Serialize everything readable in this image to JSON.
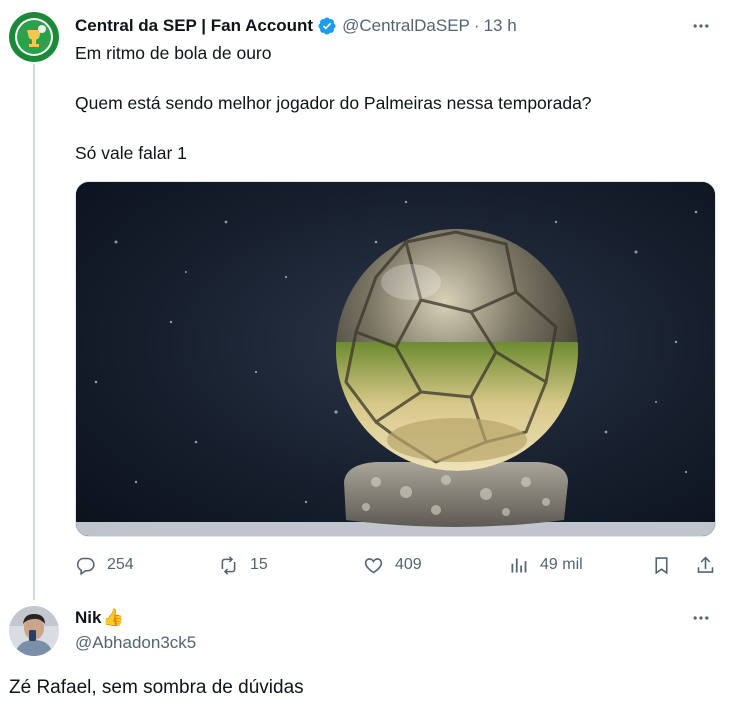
{
  "tweet": {
    "author_name": "Central da SEP | Fan Account",
    "author_handle": "@CentralDaSEP",
    "separator": "·",
    "time": "13 h",
    "lines": [
      "Em ritmo de bola de ouro",
      "Quem está sendo melhor jogador do Palmeiras nessa temporada?",
      "Só vale falar 1"
    ],
    "actions": {
      "replies": "254",
      "reposts": "15",
      "likes": "409",
      "views": "49 mil"
    }
  },
  "reply": {
    "author_name": "Nik",
    "author_emoji": "👍",
    "author_handle": "@Abhadon3ck5",
    "text": "Zé Rafael, sem sombra de dúvidas"
  },
  "icons": {
    "more": "more-horizontal-icon",
    "verified": "verified-badge-icon",
    "reply": "reply-icon",
    "repost": "repost-icon",
    "like": "heart-icon",
    "views": "analytics-icon",
    "bookmark": "bookmark-icon",
    "share": "share-icon"
  },
  "colors": {
    "text": "#0f1419",
    "secondary": "#536471",
    "verified": "#1d9bf0",
    "thread_line": "#cfd9de"
  }
}
